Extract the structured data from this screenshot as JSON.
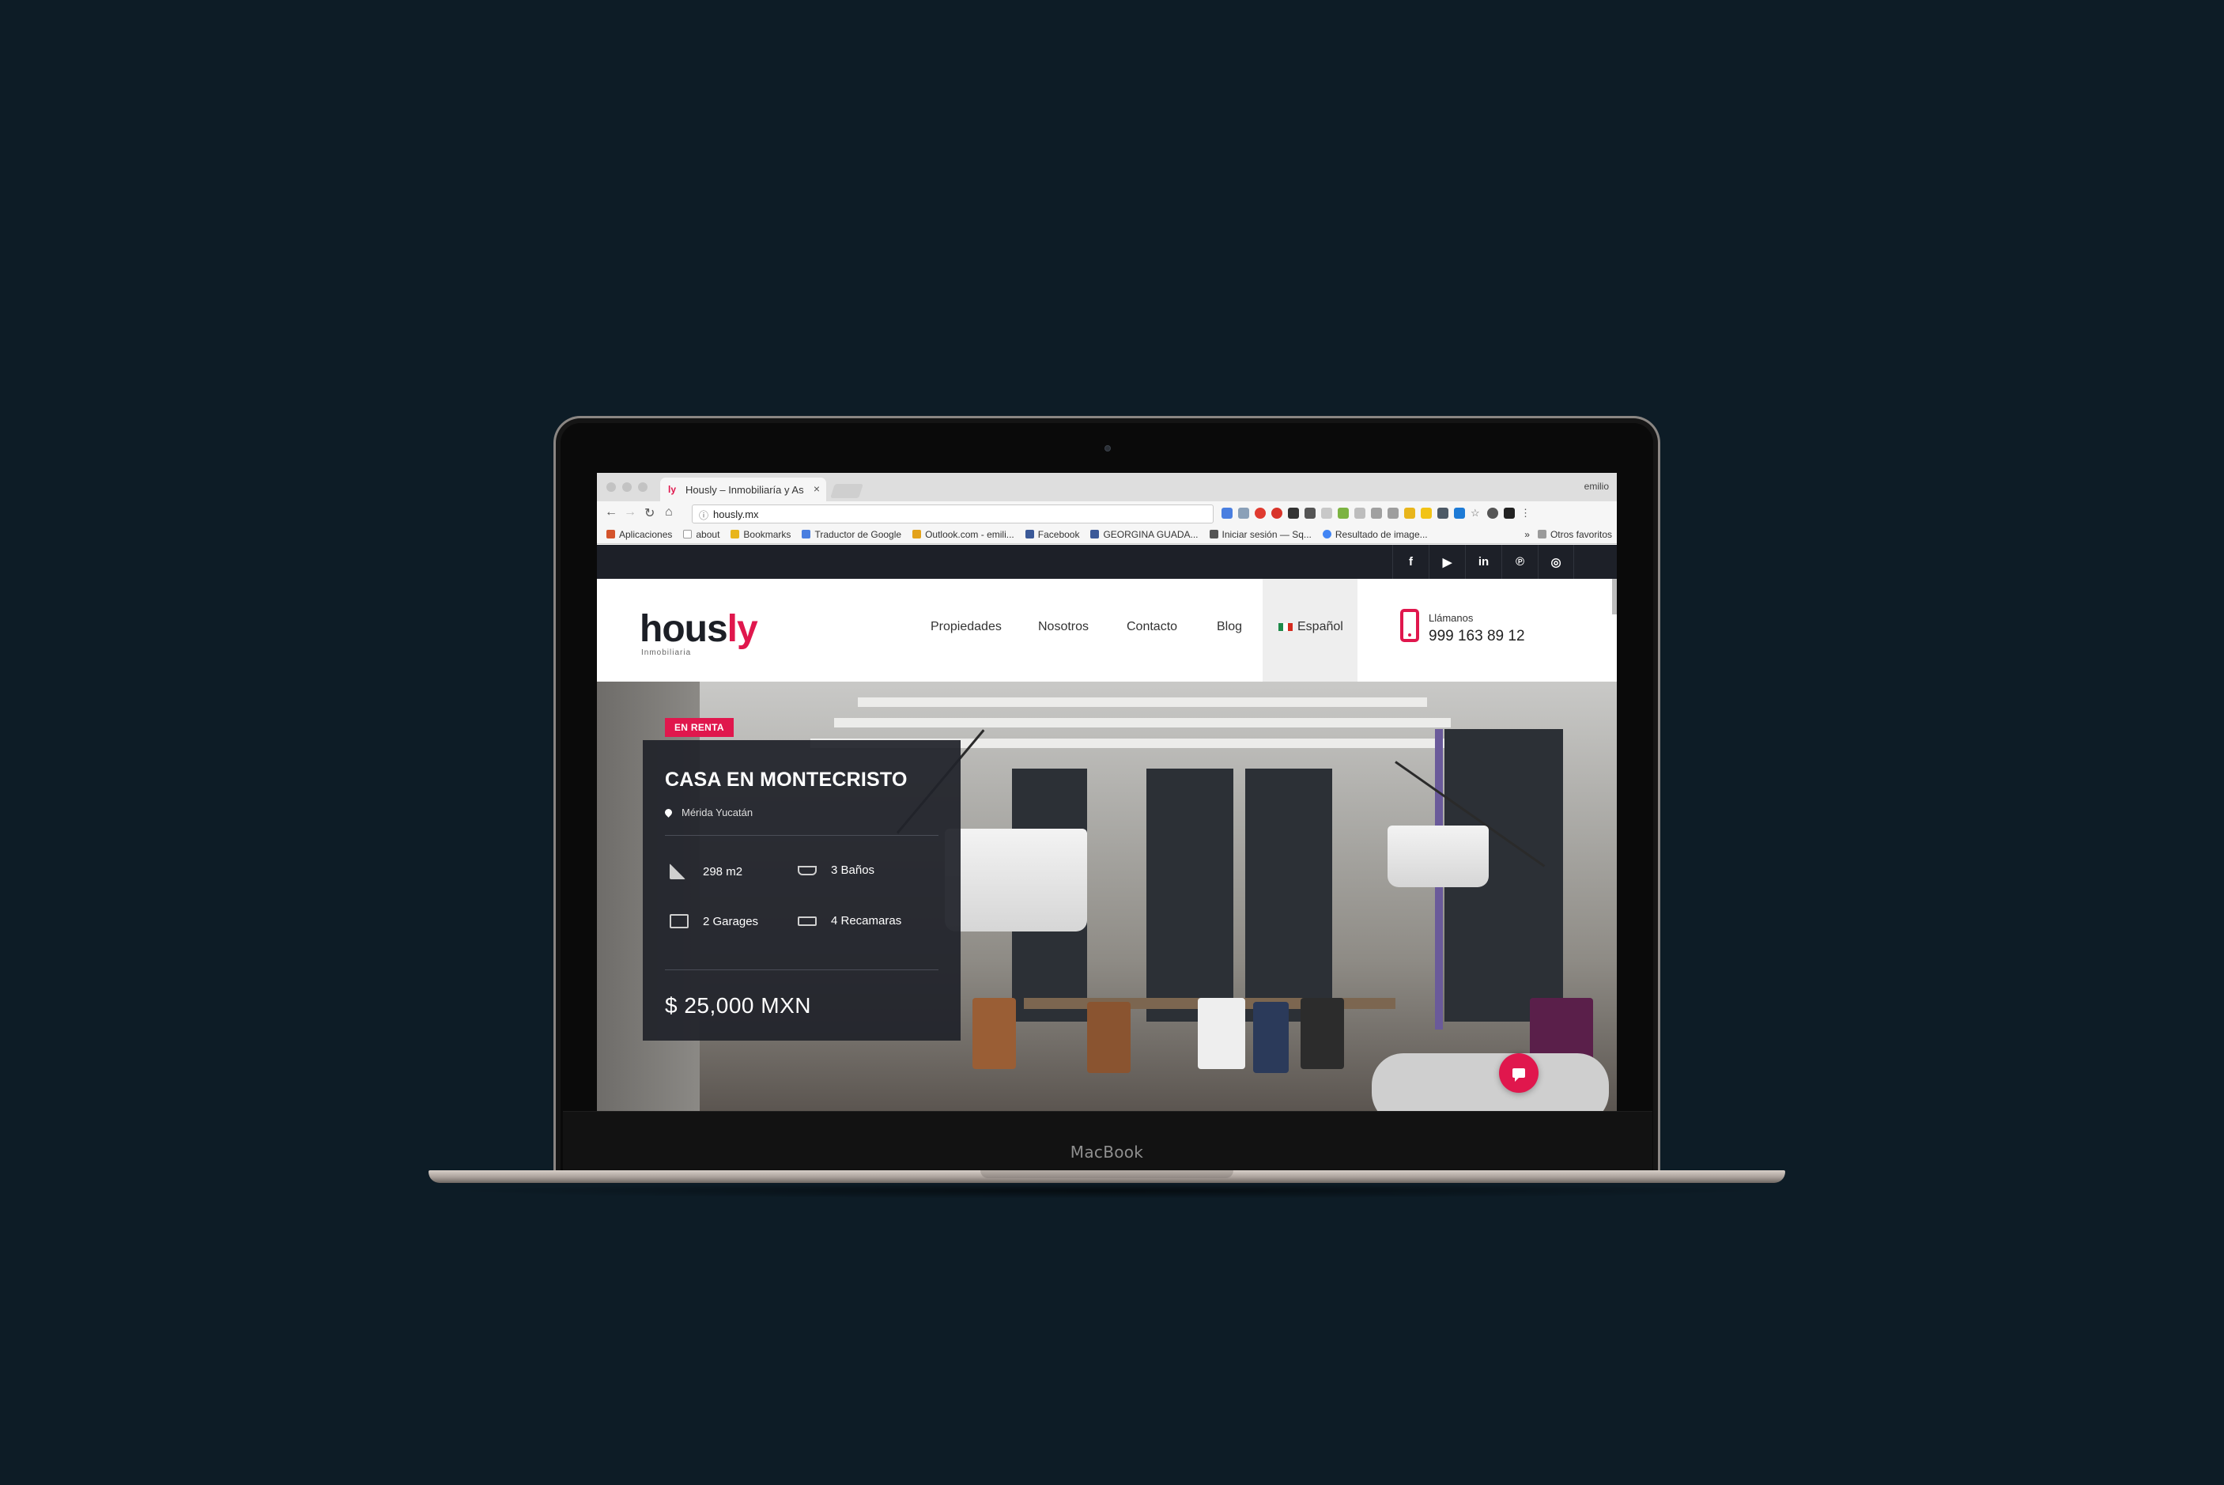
{
  "device": {
    "brand_label": "MacBook"
  },
  "browser": {
    "tab_title": "Hously – Inmobiliaría y Asesor",
    "tab_close": "×",
    "profile_name": "emilio",
    "url": "hously.mx",
    "bookmarks": [
      {
        "label": "Aplicaciones",
        "icon": "apps-grid-icon",
        "color": "#d4542c"
      },
      {
        "label": "about",
        "icon": "page-icon",
        "color": "#9a9a9a"
      },
      {
        "label": "Bookmarks",
        "icon": "star-icon",
        "color": "#e8b51c"
      },
      {
        "label": "Traductor de Google",
        "icon": "translate-icon",
        "color": "#4a7fe0"
      },
      {
        "label": "Outlook.com - emili...",
        "icon": "outlook-icon",
        "color": "#e3a21a"
      },
      {
        "label": "Facebook",
        "icon": "facebook-icon",
        "color": "#3b5998"
      },
      {
        "label": "GEORGINA GUADA...",
        "icon": "facebook-icon",
        "color": "#3b5998"
      },
      {
        "label": "Iniciar sesión — Sq...",
        "icon": "squarespace-icon",
        "color": "#555555"
      },
      {
        "label": "Resultado de image...",
        "icon": "google-icon",
        "color": "#4285f4"
      }
    ],
    "bookmarks_overflow": "»",
    "other_bookmarks": "Otros favoritos"
  },
  "site": {
    "social": [
      "facebook-icon",
      "youtube-icon",
      "linkedin-icon",
      "pinterest-icon",
      "instagram-icon"
    ],
    "social_glyphs": [
      "f",
      "▶",
      "in",
      "℗",
      "◎"
    ],
    "logo": {
      "main": "hous",
      "accent": "ly",
      "sub": "Inmobiliaria"
    },
    "nav": [
      "Propiedades",
      "Nosotros",
      "Contacto",
      "Blog"
    ],
    "language": "Español",
    "phone": {
      "label": "Llámanos",
      "number": "999 163 89 12"
    },
    "accent_color": "#e0174d"
  },
  "listing": {
    "badge": "EN RENTA",
    "title": "CASA EN MONTECRISTO",
    "location": "Mérida Yucatán",
    "features": [
      {
        "label": "298 m2",
        "icon": "area-icon"
      },
      {
        "label": "3 Baños",
        "icon": "bathtub-icon"
      },
      {
        "label": "2 Garages",
        "icon": "garage-icon"
      },
      {
        "label": "4 Recamaras",
        "icon": "bed-icon"
      }
    ],
    "price": "$ 25,000 MXN"
  }
}
